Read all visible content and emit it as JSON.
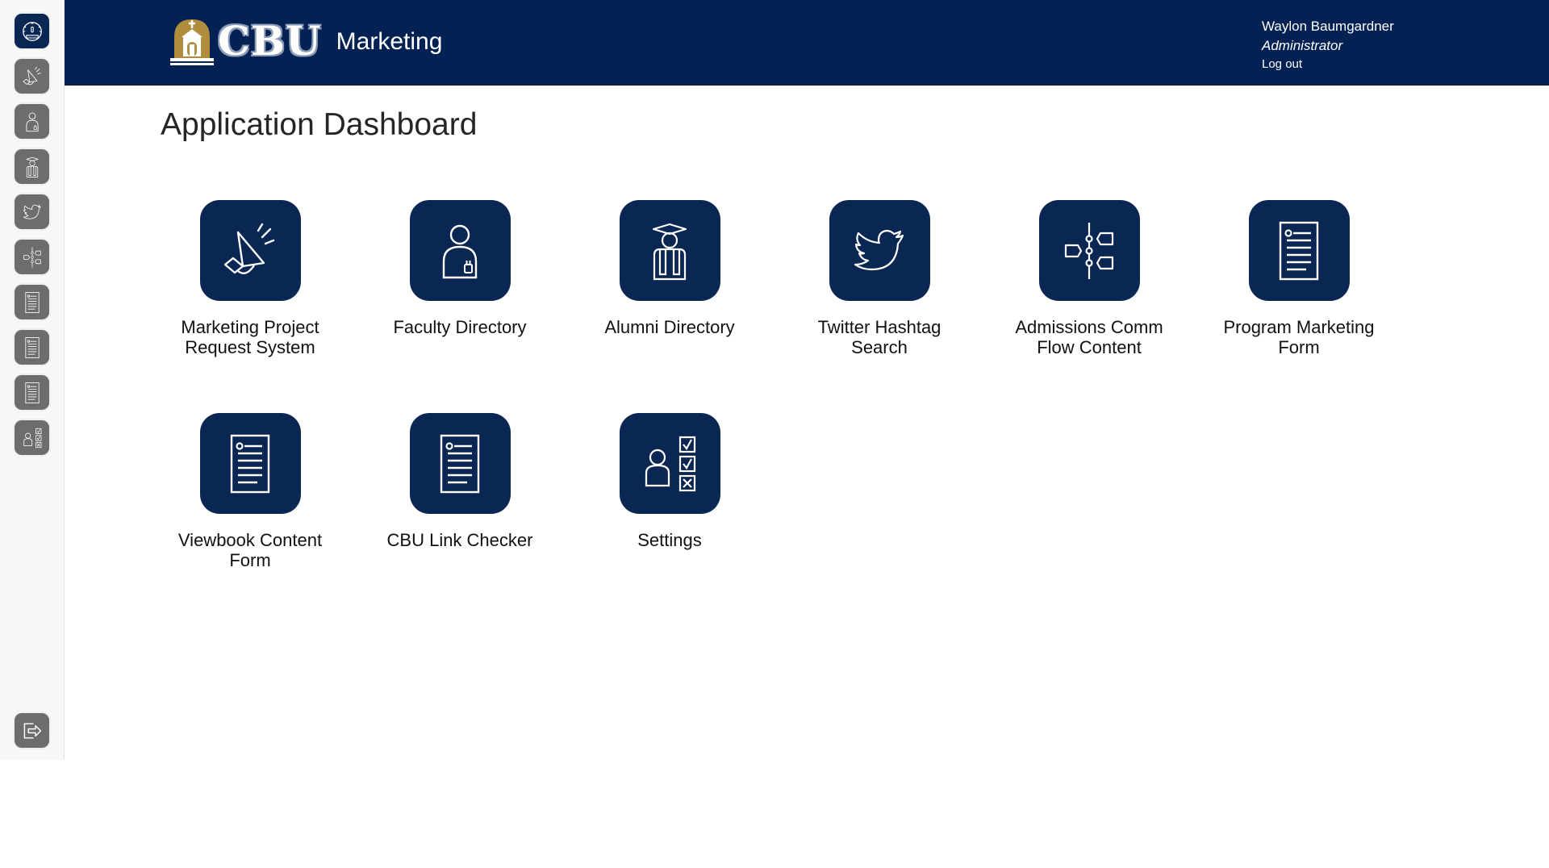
{
  "header": {
    "logo_text": "CBU",
    "logo_subtitle": "Marketing",
    "user": {
      "name": "Waylon Baumgardner",
      "role": "Administrator",
      "logout_label": "Log out"
    }
  },
  "sidebar": {
    "items": [
      {
        "icon": "dashboard-gauge-icon",
        "label": "Application Dashboard",
        "active": true
      },
      {
        "icon": "megaphone-icon",
        "label": "Marketing Project Request System"
      },
      {
        "icon": "faculty-person-icon",
        "label": "Faculty Directory"
      },
      {
        "icon": "graduate-icon",
        "label": "Alumni Directory"
      },
      {
        "icon": "twitter-bird-icon",
        "label": "Twitter Hashtag Search"
      },
      {
        "icon": "flow-timeline-icon",
        "label": "Admissions Comm Flow Content"
      },
      {
        "icon": "document-form-icon",
        "label": "Program Marketing Form"
      },
      {
        "icon": "document-form-icon",
        "label": "Viewbook Content Form"
      },
      {
        "icon": "document-form-icon",
        "label": "CBU Link Checker"
      },
      {
        "icon": "settings-checklist-icon",
        "label": "Settings"
      }
    ],
    "logout_icon": "logout-arrow-icon"
  },
  "main": {
    "title": "Application Dashboard",
    "tiles": [
      {
        "label": "Marketing Project Request System",
        "icon": "megaphone-icon"
      },
      {
        "label": "Faculty Directory",
        "icon": "faculty-person-icon"
      },
      {
        "label": "Alumni Directory",
        "icon": "graduate-icon"
      },
      {
        "label": "Twitter Hashtag Search",
        "icon": "twitter-bird-icon"
      },
      {
        "label": "Admissions Comm Flow Content",
        "icon": "flow-timeline-icon"
      },
      {
        "label": "Program Marketing Form",
        "icon": "document-form-icon"
      },
      {
        "label": "Viewbook Content Form",
        "icon": "document-form-icon"
      },
      {
        "label": "CBU Link Checker",
        "icon": "document-form-icon"
      },
      {
        "label": "Settings",
        "icon": "settings-checklist-icon"
      }
    ]
  },
  "colors": {
    "brand_navy": "#0a2653",
    "header_bg": "#032152",
    "sidebar_icon_gray": "#6d6d6d",
    "logo_gold": "#b08d3c"
  }
}
